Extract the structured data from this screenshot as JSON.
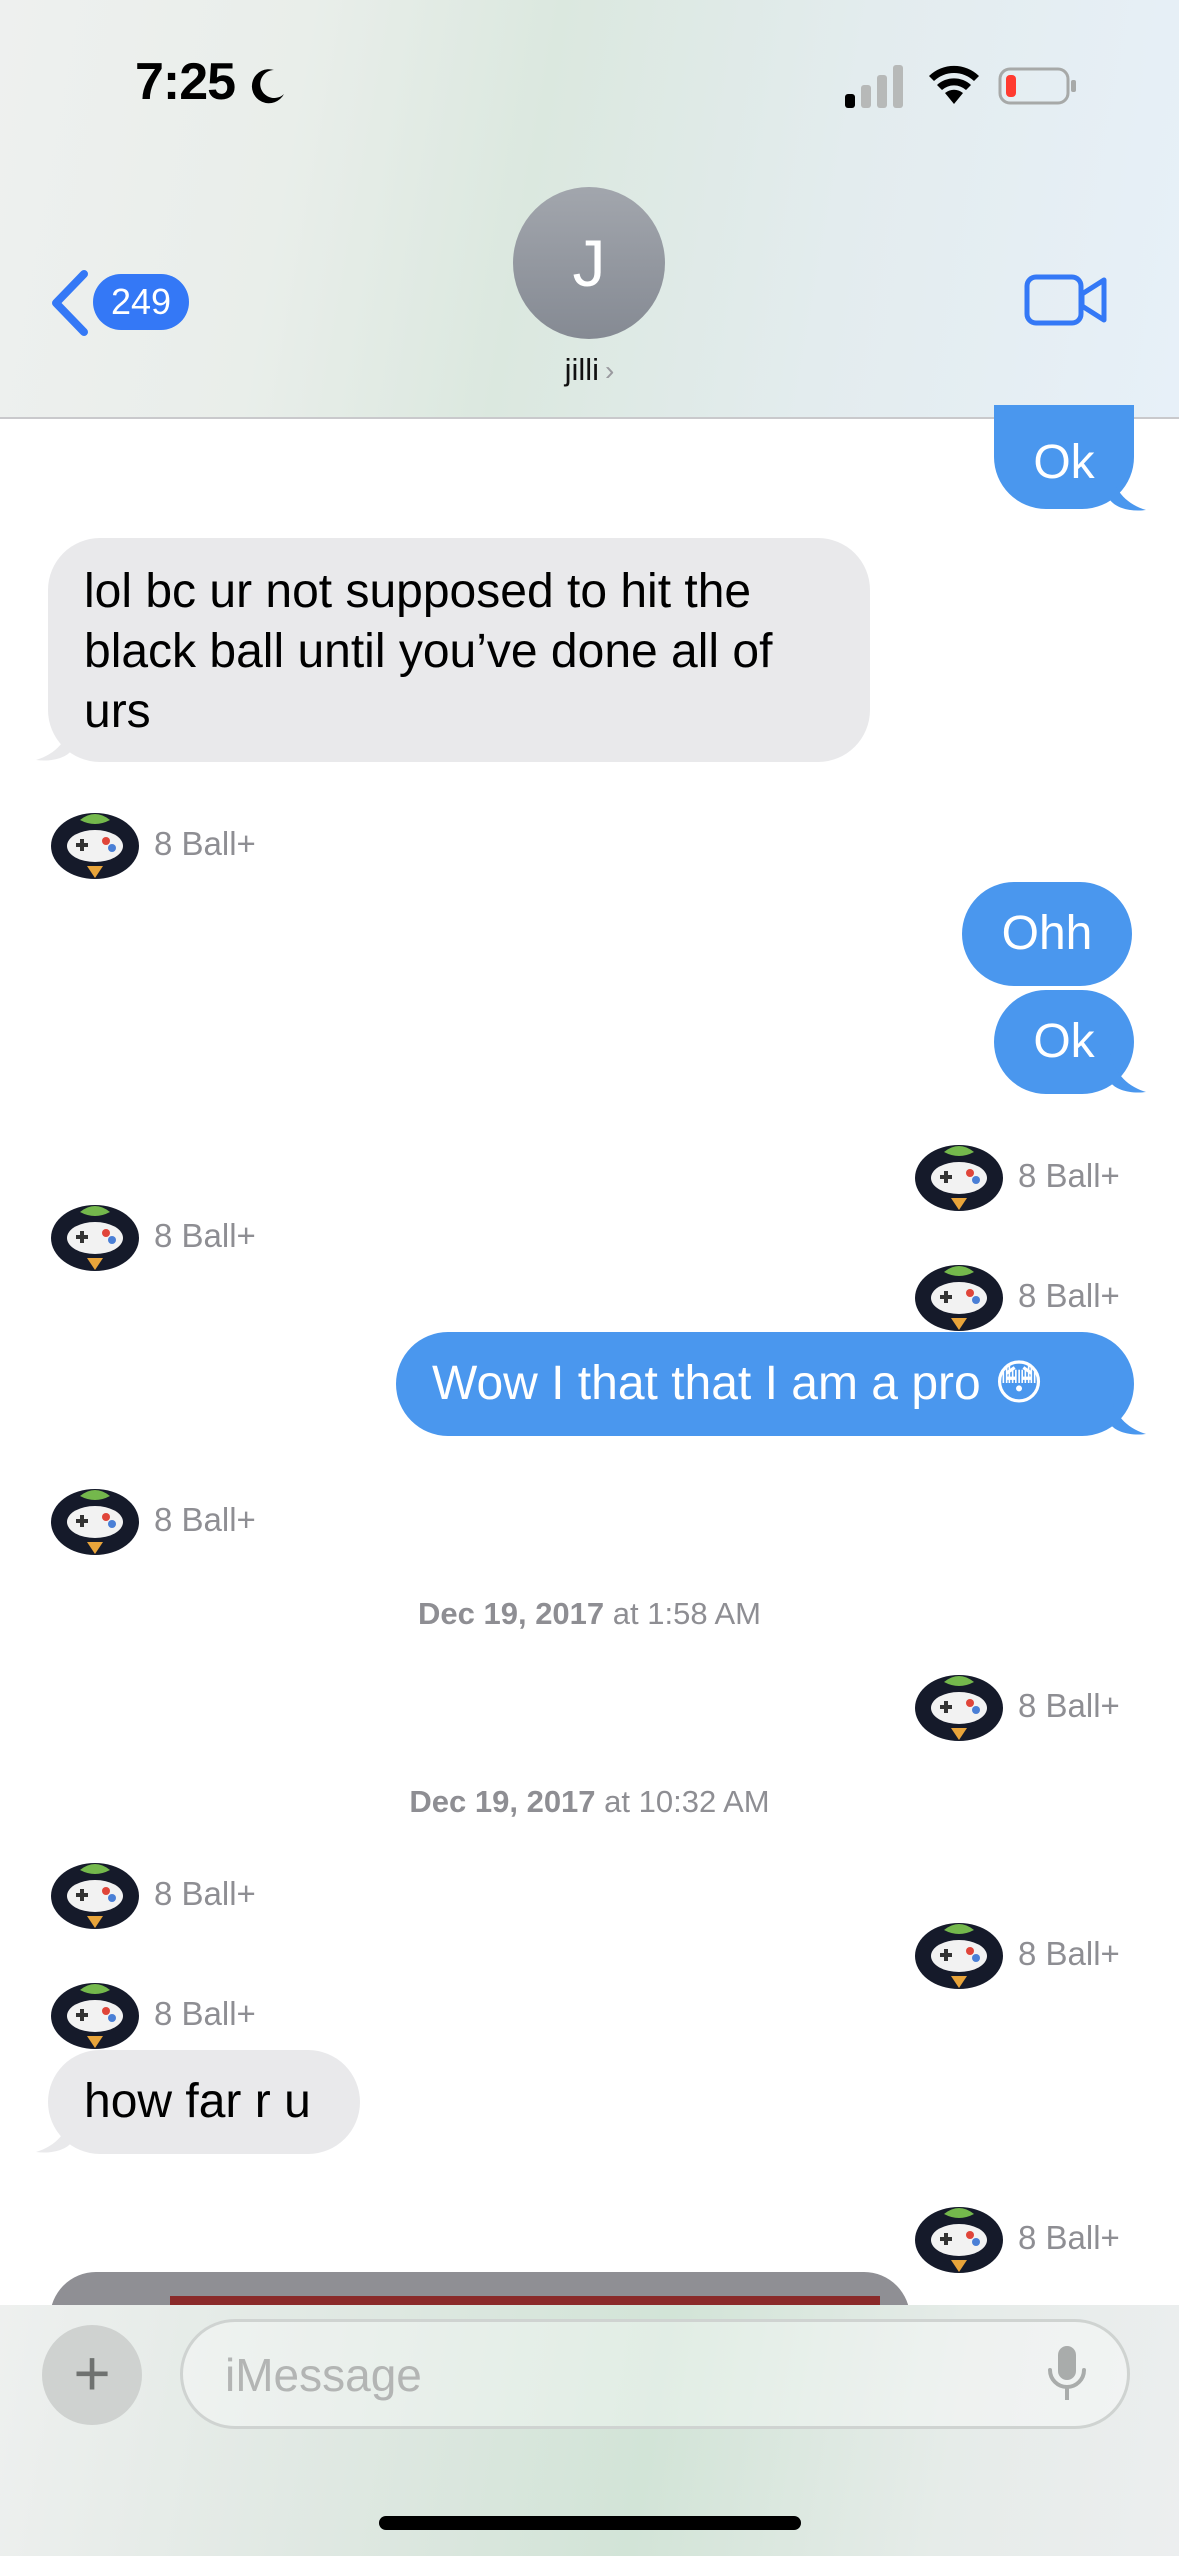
{
  "status_bar": {
    "time": "7:25"
  },
  "header": {
    "back_count": "249",
    "avatar_initial": "J",
    "contact_name": "jilli",
    "chevron": "›"
  },
  "messages": {
    "m1": "Ok",
    "m2": "lol bc ur not supposed to hit the black ball until you’ve done all of urs",
    "m3": "Ohh",
    "m4": "Ok",
    "m5": "Wow I that that I am a pro 😳",
    "m6": "how far r u"
  },
  "app_name": "8 Ball+",
  "timestamps": [
    {
      "date": "Dec 19, 2017",
      "time": " at 1:58 AM"
    },
    {
      "date": "Dec 19, 2017",
      "time": " at 10:32 AM"
    }
  ],
  "input": {
    "placeholder": "iMessage",
    "plus": "+"
  },
  "colors": {
    "outgoing": "#4a97ee",
    "incoming": "#e9e9eb",
    "accent": "#3478f6"
  }
}
